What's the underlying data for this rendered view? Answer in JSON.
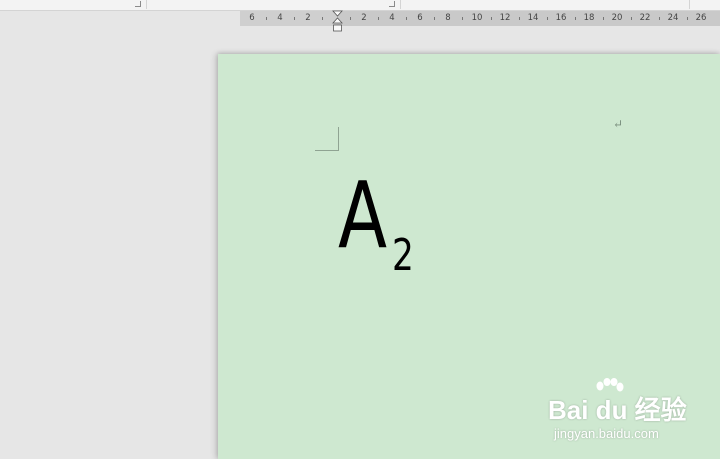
{
  "ruler": {
    "numbers": [
      "6",
      "4",
      "2",
      "2",
      "4",
      "6",
      "8",
      "10",
      "12",
      "14",
      "16",
      "18",
      "20",
      "22",
      "24",
      "26"
    ]
  },
  "document": {
    "formula": {
      "base": "A",
      "subscript": "2"
    },
    "paragraph_mark": "↵"
  },
  "watermark": {
    "logo": "Bai du 经验",
    "url": "jingyan.baidu.com"
  },
  "colors": {
    "page_background": "#cee8d0",
    "workspace": "#e6e6e6"
  }
}
